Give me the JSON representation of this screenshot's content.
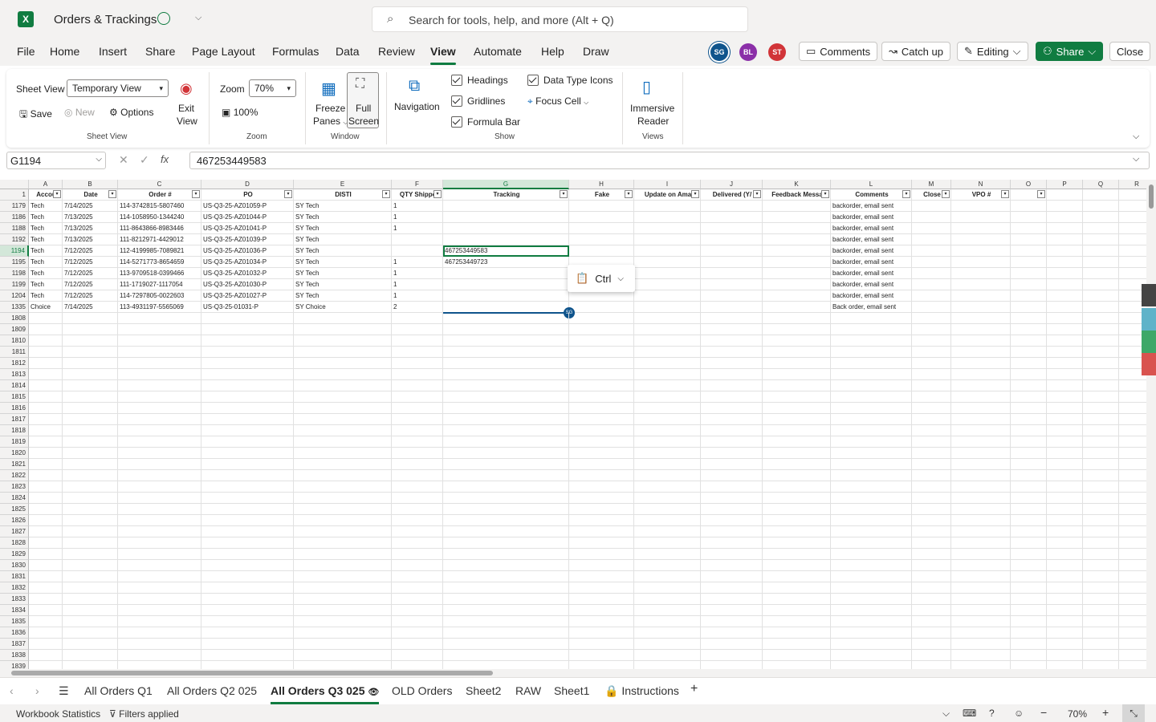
{
  "titlebar": {
    "app_title": "Orders & Trackings",
    "search_placeholder": "Search for tools, help, and more (Alt + Q)"
  },
  "menu": [
    "File",
    "Home",
    "Insert",
    "Share",
    "Page Layout",
    "Formulas",
    "Data",
    "Review",
    "View",
    "Automate",
    "Help",
    "Draw"
  ],
  "avatars": [
    "SG",
    "BL",
    "ST"
  ],
  "top_buttons": {
    "comments": "Comments",
    "catchup": "Catch up",
    "editing": "Editing",
    "share": "Share",
    "close": "Close"
  },
  "ribbon": {
    "sheet_view_label": "Sheet View",
    "sheet_view_value": "Temporary View",
    "save": "Save",
    "new": "New",
    "options": "Options",
    "exit": "Exit",
    "view": "View",
    "group_sheet_view": "Sheet View",
    "zoom_label": "Zoom",
    "zoom_value": "70%",
    "zoom_100": "100%",
    "group_zoom": "Zoom",
    "freeze": "Freeze",
    "panes": "Panes",
    "full": "Full",
    "screen": "Screen",
    "group_window": "Window",
    "navigation": "Navigation",
    "headings": "Headings",
    "gridlines": "Gridlines",
    "formula_bar": "Formula Bar",
    "data_type_icons": "Data Type Icons",
    "focus_cell": "Focus Cell",
    "group_show": "Show",
    "immersive": "Immersive",
    "reader": "Reader",
    "group_views": "Views"
  },
  "formula": {
    "namebox": "G1194",
    "value": "467253449583"
  },
  "columns": [
    "A",
    "B",
    "C",
    "D",
    "E",
    "F",
    "G",
    "H",
    "I",
    "J",
    "K",
    "L",
    "M",
    "N",
    "O",
    "P",
    "Q",
    "R"
  ],
  "headers": [
    "Accou",
    "Date",
    "Order #",
    "PO",
    "DISTI",
    "QTY Shippe",
    "Tracking",
    "Fake",
    "Update on Ama",
    "Delivered (Y/",
    "Feedback Messa",
    "Comments",
    "Close",
    "VPO #",
    "",
    "",
    "",
    ""
  ],
  "header_row_num": "1",
  "rows": [
    {
      "n": "1179",
      "a": "Tech",
      "b": "7/14/2025",
      "c": "114-3742815-5807460",
      "d": "US-Q3-25-AZ01059-P",
      "e": "SY Tech",
      "f": "1",
      "g": "",
      "l": "backorder, email sent"
    },
    {
      "n": "1186",
      "a": "Tech",
      "b": "7/13/2025",
      "c": "114-1058950-1344240",
      "d": "US-Q3-25-AZ01044-P",
      "e": "SY Tech",
      "f": "1",
      "g": "",
      "l": "backorder, email sent"
    },
    {
      "n": "1188",
      "a": "Tech",
      "b": "7/13/2025",
      "c": "111-8643866-8983446",
      "d": "US-Q3-25-AZ01041-P",
      "e": "SY Tech",
      "f": "1",
      "g": "",
      "l": "backorder, email sent"
    },
    {
      "n": "1192",
      "a": "Tech",
      "b": "7/13/2025",
      "c": "111-8212971-4429012",
      "d": "US-Q3-25-AZ01039-P",
      "e": "SY Tech",
      "f": "",
      "g": "",
      "l": "backorder, email sent"
    },
    {
      "n": "1194",
      "a": "Tech",
      "b": "7/12/2025",
      "c": "112-4199985-7089821",
      "d": "US-Q3-25-AZ01036-P",
      "e": "SY Tech",
      "f": "",
      "g": "467253449583",
      "l": "backorder, email sent"
    },
    {
      "n": "1195",
      "a": "Tech",
      "b": "7/12/2025",
      "c": "114-5271773-8654659",
      "d": "US-Q3-25-AZ01034-P",
      "e": "SY Tech",
      "f": "1",
      "g": "467253449723",
      "l": "backorder, email sent"
    },
    {
      "n": "1198",
      "a": "Tech",
      "b": "7/12/2025",
      "c": "113-9709518-0399466",
      "d": "US-Q3-25-AZ01032-P",
      "e": "SY Tech",
      "f": "1",
      "g": "",
      "l": "backorder, email sent"
    },
    {
      "n": "1199",
      "a": "Tech",
      "b": "7/12/2025",
      "c": "111-1719027-1117054",
      "d": "US-Q3-25-AZ01030-P",
      "e": "SY Tech",
      "f": "1",
      "g": "",
      "l": "backorder, email sent"
    },
    {
      "n": "1204",
      "a": "Tech",
      "b": "7/12/2025",
      "c": "114-7297805-0022603",
      "d": "US-Q3-25-AZ01027-P",
      "e": "SY Tech",
      "f": "1",
      "g": "",
      "l": "backorder, email sent"
    },
    {
      "n": "1335",
      "a": "Choice",
      "b": "7/14/2025",
      "c": "113-4931197-5565069",
      "d": "US-Q3-25-01031-P",
      "e": "SY Choice",
      "f": "2",
      "g": "",
      "l": "Back order, email sent"
    }
  ],
  "empty_rows": [
    "1808",
    "1809",
    "1810",
    "1811",
    "1812",
    "1813",
    "1814",
    "1815",
    "1816",
    "1817",
    "1818",
    "1819",
    "1820",
    "1821",
    "1822",
    "1823",
    "1824",
    "1825",
    "1826",
    "1827",
    "1828",
    "1829",
    "1830",
    "1831",
    "1832",
    "1833",
    "1834",
    "1835",
    "1836",
    "1837",
    "1838",
    "1839"
  ],
  "paste_popup": "Ctrl",
  "sheet_tabs": [
    "All Orders Q1",
    "All Orders Q2 025",
    "All Orders Q3 025",
    "OLD Orders",
    "Sheet2",
    "RAW",
    "Sheet1",
    "Instructions"
  ],
  "status": {
    "workbook_stats": "Workbook Statistics",
    "filters": "Filters applied",
    "zoom": "70%"
  },
  "colors": {
    "accent": "#107c41",
    "avatar_sg": "#0f548c",
    "avatar_bl": "#8b2fa8",
    "avatar_st": "#d13438"
  }
}
